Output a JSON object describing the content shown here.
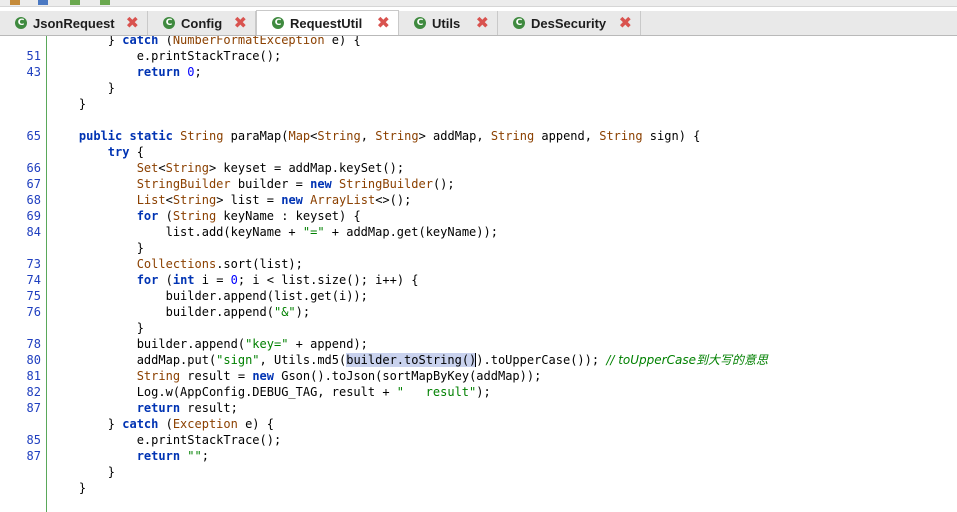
{
  "tabs": [
    {
      "label": "JsonRequest",
      "icon": "class-icon",
      "active": false
    },
    {
      "label": "Config",
      "icon": "class-icon",
      "active": false
    },
    {
      "label": "RequestUtil",
      "icon": "class-icon",
      "active": true
    },
    {
      "label": "Utils",
      "icon": "class-icon",
      "active": false
    },
    {
      "label": "DesSecurity",
      "icon": "class-icon",
      "active": false
    }
  ],
  "tab_icon_glyph": "C",
  "tab_close_glyph": "✖",
  "colors": {
    "keyword": "#0033b3",
    "type": "#8b4000",
    "string": "#008000",
    "line_number": "#1f3fbf",
    "gutter_border": "#5aa85a",
    "selection": "#c9d2ee",
    "close": "#d9534f"
  },
  "code_lines": [
    {
      "ln": "",
      "text": "        } catch (NumberFormatException e) {"
    },
    {
      "ln": "51",
      "text": "            e.printStackTrace();"
    },
    {
      "ln": "43",
      "text": "            return 0;"
    },
    {
      "ln": "",
      "text": "        }"
    },
    {
      "ln": "",
      "text": "    }"
    },
    {
      "ln": "",
      "text": ""
    },
    {
      "ln": "65",
      "text": "    public static String paraMap(Map<String, String> addMap, String append, String sign) {"
    },
    {
      "ln": "",
      "text": "        try {"
    },
    {
      "ln": "66",
      "text": "            Set<String> keyset = addMap.keySet();"
    },
    {
      "ln": "67",
      "text": "            StringBuilder builder = new StringBuilder();"
    },
    {
      "ln": "68",
      "text": "            List<String> list = new ArrayList<>();"
    },
    {
      "ln": "69",
      "text": "            for (String keyName : keyset) {"
    },
    {
      "ln": "84",
      "text": "                list.add(keyName + \"=\" + addMap.get(keyName));"
    },
    {
      "ln": "",
      "text": "            }"
    },
    {
      "ln": "73",
      "text": "            Collections.sort(list);"
    },
    {
      "ln": "74",
      "text": "            for (int i = 0; i < list.size(); i++) {"
    },
    {
      "ln": "75",
      "text": "                builder.append(list.get(i));"
    },
    {
      "ln": "76",
      "text": "                builder.append(\"&\");"
    },
    {
      "ln": "",
      "text": "            }"
    },
    {
      "ln": "78",
      "text": "            builder.append(\"key=\" + append);"
    },
    {
      "ln": "80",
      "text": "            addMap.put(\"sign\", Utils.md5(builder.toString()).toUpperCase()); // toUpperCase到大写的意思"
    },
    {
      "ln": "81",
      "text": "            String result = new Gson().toJson(sortMapByKey(addMap));"
    },
    {
      "ln": "82",
      "text": "            Log.w(AppConfig.DEBUG_TAG, result + \"   result\");"
    },
    {
      "ln": "87",
      "text": "            return result;"
    },
    {
      "ln": "",
      "text": "        } catch (Exception e) {"
    },
    {
      "ln": "85",
      "text": "            e.printStackTrace();"
    },
    {
      "ln": "87",
      "text": "            return \"\";"
    },
    {
      "ln": "",
      "text": "        }"
    },
    {
      "ln": "",
      "text": "    }"
    },
    {
      "ln": "",
      "text": ""
    }
  ],
  "selection": {
    "line_index": 20,
    "text": "builder.toString()"
  }
}
